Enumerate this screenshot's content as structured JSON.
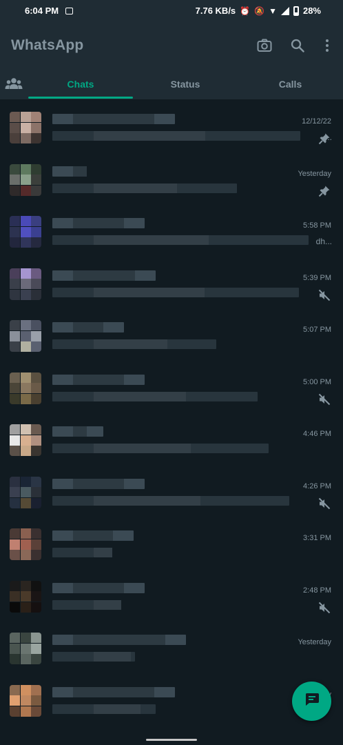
{
  "status_bar": {
    "time": "6:04 PM",
    "network_speed": "7.76 KB/s",
    "battery": "28%",
    "icons": [
      "gallery-icon",
      "alarm-icon",
      "mute-notification-icon",
      "wifi-icon",
      "signal-icon",
      "battery-icon"
    ]
  },
  "header": {
    "title": "WhatsApp",
    "icons": [
      "camera-icon",
      "search-icon",
      "more-options-icon"
    ]
  },
  "tabs": [
    {
      "label": "",
      "icon": "community-icon"
    },
    {
      "label": "Chats",
      "active": true
    },
    {
      "label": "Status"
    },
    {
      "label": "Calls"
    }
  ],
  "chats": [
    {
      "time": "12/12/22",
      "snippet": "...",
      "badge_icon": "pin-icon"
    },
    {
      "time": "Yesterday",
      "snippet": "",
      "badge_icon": "pin-icon"
    },
    {
      "time": "5:58 PM",
      "snippet": "dh...",
      "badge_icon": ""
    },
    {
      "time": "5:39 PM",
      "snippet": "",
      "badge_icon": "muted-icon"
    },
    {
      "time": "5:07 PM",
      "snippet": "",
      "badge_icon": ""
    },
    {
      "time": "5:00 PM",
      "snippet": "",
      "badge_icon": "muted-icon"
    },
    {
      "time": "4:46 PM",
      "snippet": "",
      "badge_icon": ""
    },
    {
      "time": "4:26 PM",
      "snippet": "",
      "badge_icon": "muted-icon"
    },
    {
      "time": "3:31 PM",
      "snippet": "",
      "badge_icon": ""
    },
    {
      "time": "2:48 PM",
      "snippet": "",
      "badge_icon": "muted-icon"
    },
    {
      "time": "Yesterday",
      "snippet": "",
      "badge_icon": ""
    },
    {
      "time": "...day",
      "snippet": "",
      "badge_icon": ""
    }
  ],
  "fab": {
    "icon": "new-chat-icon"
  },
  "colors": {
    "accent": "#00a884",
    "background": "#111b21",
    "bar": "#1f2c34",
    "secondary_text": "#8696a0"
  }
}
